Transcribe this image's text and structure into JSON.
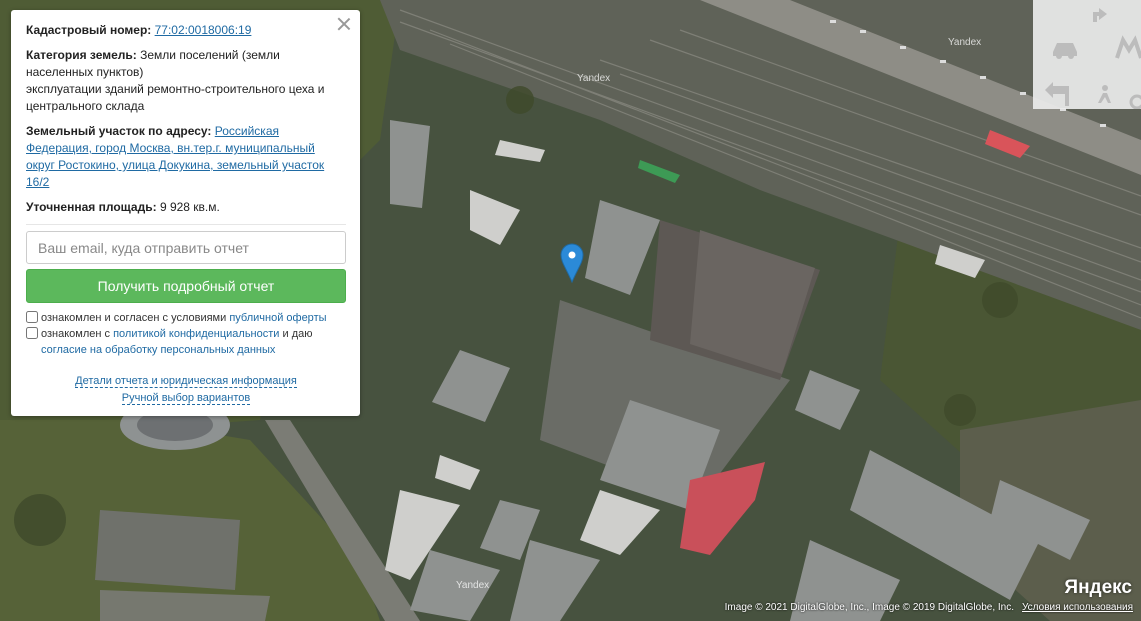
{
  "info": {
    "cadastral_label": "Кадастровый номер:",
    "cadastral_value": "77:02:0018006:19",
    "category_label": "Категория земель:",
    "category_value": "Земли поселений (земли населенных пунктов)",
    "usage": "эксплуатации зданий ремонтно-строительного цеха и центрального склада",
    "address_label": "Земельный участок по адресу:",
    "address_value": "Российская Федерация, город Москва, вн.тер.г. муниципальный округ Ростокино, улица Докукина, земельный участок 16/2",
    "area_label": "Уточненная площадь:",
    "area_value": "9 928 кв.м."
  },
  "form": {
    "email_placeholder": "Ваш email, куда отправить отчет",
    "submit_label": "Получить подробный отчет",
    "agree1_prefix": "ознакомлен и согласен с условиями",
    "agree1_link": "публичной оферты",
    "agree2_prefix": "ознакомлен с",
    "agree2_link": "политикой конфиденциальности",
    "agree2_mid": "и даю",
    "agree2_link2": "согласие на обработку персональных данных"
  },
  "footer_links": {
    "details": "Детали отчета и юридическая информация",
    "manual": "Ручной выбор вариантов"
  },
  "map": {
    "watermark": "Yandex",
    "logo": "Яндекс",
    "attribution": "Image © 2021 DigitalGlobe, Inc., Image © 2019 DigitalGlobe, Inc.",
    "terms_link": "Условия использования",
    "marker_color": "#2b8ad8"
  }
}
